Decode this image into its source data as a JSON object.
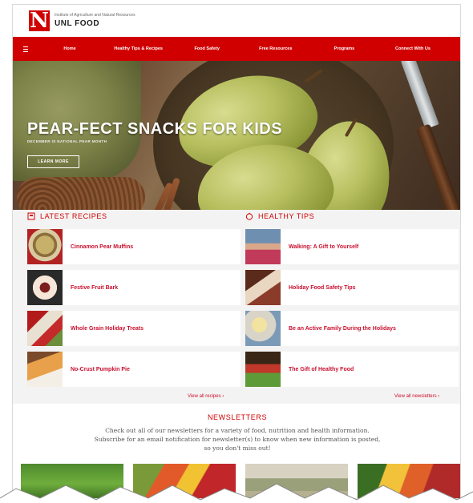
{
  "header": {
    "institute": "Institute of Agriculture and Natural Resources",
    "brand": "UNL FOOD",
    "logo_letter": "N"
  },
  "nav": {
    "items": [
      {
        "label": "Home"
      },
      {
        "label": "Healthy Tips & Recipes"
      },
      {
        "label": "Food Safety"
      },
      {
        "label": "Free Resources"
      },
      {
        "label": "Programs"
      },
      {
        "label": "Connect With Us"
      }
    ]
  },
  "hero": {
    "title": "PEAR-FECT SNACKS FOR KIDS",
    "subtitle": "DECEMBER IS NATIONAL PEAR MONTH",
    "button": "LEARN MORE"
  },
  "latest_recipes": {
    "title": "LATEST RECIPES",
    "items": [
      {
        "title": "Cinnamon Pear Muffins"
      },
      {
        "title": "Festive Fruit Bark"
      },
      {
        "title": "Whole Grain Holiday Treats"
      },
      {
        "title": "No-Crust Pumpkin Pie"
      }
    ],
    "view_all": "View all recipes ›"
  },
  "healthy_tips": {
    "title": "HEALTHY TIPS",
    "items": [
      {
        "title": "Walking: A Gift to Yourself"
      },
      {
        "title": "Holiday Food Safety Tips"
      },
      {
        "title": "Be an Active Family During the Holidays"
      },
      {
        "title": "The Gift of Healthy Food"
      }
    ],
    "view_all": "View all newsletters ›"
  },
  "newsletters": {
    "title": "NEWSLETTERS",
    "text": "Check out all of our newsletters for a variety of food, nutrition and health information. Subscribe for an email notification for newsletter(s) to know when new information is posted, so you don't miss out!"
  },
  "colors": {
    "brand_red": "#d00000",
    "link_red": "#c8102e",
    "background": "#f4f3f3"
  }
}
